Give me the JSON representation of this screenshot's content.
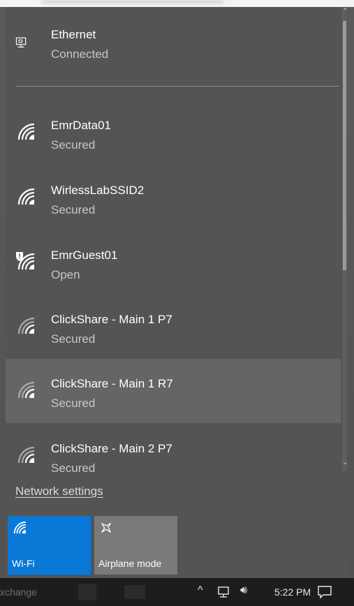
{
  "networks": {
    "ethernet": {
      "name": "Ethernet",
      "status": "Connected",
      "icon": "ethernet-icon"
    },
    "wifi": [
      {
        "name": "EmrData01",
        "status": "Secured",
        "icon": "wifi-signal-icon"
      },
      {
        "name": "WirlessLabSSID2",
        "status": "Secured",
        "icon": "wifi-signal-icon"
      },
      {
        "name": "EmrGuest01",
        "status": "Open",
        "icon": "wifi-open-shield-icon"
      },
      {
        "name": "ClickShare - Main 1 P7",
        "status": "Secured",
        "icon": "wifi-signal-icon"
      },
      {
        "name": "ClickShare - Main 1 R7",
        "status": "Secured",
        "icon": "wifi-signal-icon"
      },
      {
        "name": "ClickShare - Main 2 P7",
        "status": "Secured",
        "icon": "wifi-signal-icon"
      }
    ]
  },
  "network_settings_label": "Network settings",
  "quick_actions": {
    "wifi": {
      "label": "Wi-Fi",
      "active": true,
      "color": "#0a78d7"
    },
    "airplane": {
      "label": "Airplane mode",
      "active": false
    }
  },
  "taskbar": {
    "partial_text": "xchange",
    "time": "5:22 PM",
    "tray_icons": [
      "chevron-up-icon",
      "network-icon",
      "volume-icon"
    ],
    "notification_icon": "action-center-icon"
  },
  "colors": {
    "accent": "#0a78d7",
    "flyout_bg": "#545454",
    "taskbar_bg": "#1d1d1d"
  }
}
